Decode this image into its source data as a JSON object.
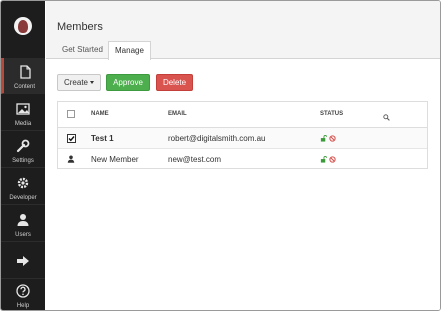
{
  "sidebar": {
    "items": [
      {
        "label": "Content",
        "icon": "document-icon",
        "active": true
      },
      {
        "label": "Media",
        "icon": "image-icon"
      },
      {
        "label": "Settings",
        "icon": "wrench-icon"
      },
      {
        "label": "Developer",
        "icon": "gear-icon"
      },
      {
        "label": "Users",
        "icon": "user-icon"
      },
      {
        "label": "",
        "icon": "arrow-right-icon"
      },
      {
        "label": "Help",
        "icon": "help-icon"
      }
    ]
  },
  "header": {
    "title": "Members",
    "tabs": [
      {
        "label": "Get Started"
      },
      {
        "label": "Manage",
        "active": true
      }
    ]
  },
  "toolbar": {
    "create_label": "Create",
    "approve_label": "Approve",
    "delete_label": "Delete"
  },
  "table": {
    "columns": {
      "name": "NAME",
      "email": "EMAIL",
      "status": "STATUS"
    },
    "rows": [
      {
        "name": "Test 1",
        "email": "robert@digitalsmith.com.au",
        "selected": true
      },
      {
        "name": "New Member",
        "email": "new@test.com",
        "selected": false
      }
    ]
  },
  "colors": {
    "approve": "#4cae4c",
    "delete": "#d9534f",
    "active_accent": "#b44a3c",
    "status_approved": "#3a9a3a",
    "status_locked": "#d9534f"
  }
}
